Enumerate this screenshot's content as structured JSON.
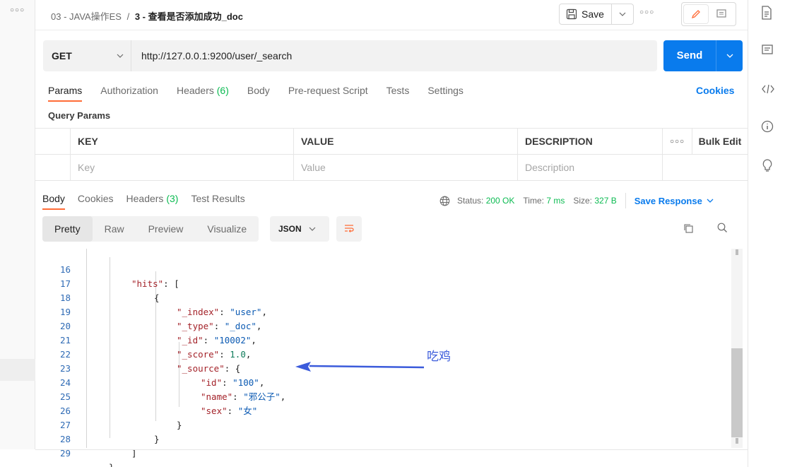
{
  "header": {
    "breadcrumb_parent": "03 - JAVA操作ES",
    "breadcrumb_sep": "/",
    "breadcrumb_current": "3 - 查看是否添加成功_doc",
    "save_label": "Save"
  },
  "request": {
    "method": "GET",
    "url": "http://127.0.0.1:9200/user/_search",
    "send_label": "Send"
  },
  "request_tabs": {
    "params": "Params",
    "authorization": "Authorization",
    "headers": "Headers",
    "headers_count": "(6)",
    "body": "Body",
    "prerequest": "Pre-request Script",
    "tests": "Tests",
    "settings": "Settings",
    "cookies": "Cookies"
  },
  "query_params": {
    "title": "Query Params",
    "col_key": "KEY",
    "col_value": "VALUE",
    "col_description": "DESCRIPTION",
    "bulk_edit": "Bulk Edit",
    "ph_key": "Key",
    "ph_value": "Value",
    "ph_description": "Description"
  },
  "response_tabs": {
    "body": "Body",
    "cookies": "Cookies",
    "headers": "Headers",
    "headers_count": "(3)",
    "test_results": "Test Results"
  },
  "status": {
    "status_label": "Status:",
    "status_value": "200 OK",
    "time_label": "Time:",
    "time_value": "7 ms",
    "size_label": "Size:",
    "size_value": "327 B",
    "save_response": "Save Response"
  },
  "view_modes": {
    "pretty": "Pretty",
    "raw": "Raw",
    "preview": "Preview",
    "visualize": "Visualize",
    "format": "JSON"
  },
  "code": {
    "l16": {
      "n": "16",
      "key": "\"hits\"",
      "rest": ": ["
    },
    "l17": {
      "n": "17",
      "rest": "{"
    },
    "l18": {
      "n": "18",
      "key": "\"_index\"",
      "sep": ": ",
      "val": "\"user\"",
      "end": ","
    },
    "l19": {
      "n": "19",
      "key": "\"_type\"",
      "sep": ": ",
      "val": "\"_doc\"",
      "end": ","
    },
    "l20": {
      "n": "20",
      "key": "\"_id\"",
      "sep": ": ",
      "val": "\"10002\"",
      "end": ","
    },
    "l21": {
      "n": "21",
      "key": "\"_score\"",
      "sep": ": ",
      "val": "1.0",
      "end": ","
    },
    "l22": {
      "n": "22",
      "key": "\"_source\"",
      "rest": ": {"
    },
    "l23": {
      "n": "23",
      "key": "\"id\"",
      "sep": ": ",
      "val": "\"100\"",
      "end": ","
    },
    "l24": {
      "n": "24",
      "key": "\"name\"",
      "sep": ": ",
      "val": "\"邪公子\"",
      "end": ","
    },
    "l25": {
      "n": "25",
      "key": "\"sex\"",
      "sep": ": ",
      "val": "\"女\""
    },
    "l26": {
      "n": "26",
      "rest": "}"
    },
    "l27": {
      "n": "27",
      "rest": "}"
    },
    "l28": {
      "n": "28",
      "rest": "]"
    },
    "l29": {
      "n": "29",
      "rest": "}"
    }
  },
  "annotation": {
    "text": "吃鸡",
    "color": "#3b5bdb"
  },
  "colors": {
    "accent_orange": "#ff6c37",
    "send_blue": "#097bed",
    "status_green": "#0cbb52"
  }
}
